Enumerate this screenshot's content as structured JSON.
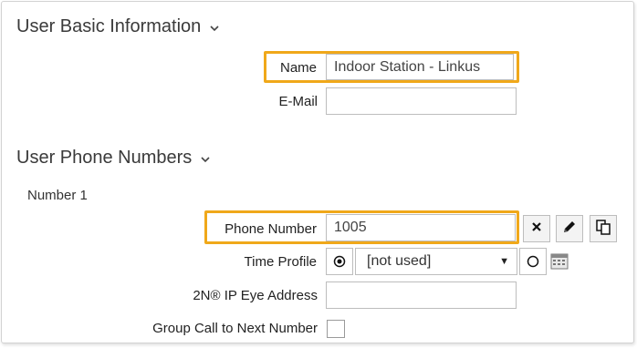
{
  "basic_info": {
    "title": "User Basic Information",
    "name_label": "Name",
    "name_value": "Indoor Station - Linkus",
    "email_label": "E-Mail",
    "email_value": ""
  },
  "phone_numbers": {
    "title": "User Phone Numbers",
    "number_heading": "Number 1",
    "phone_label": "Phone Number",
    "phone_value": "1005",
    "time_profile_label": "Time Profile",
    "time_profile_value": "[not used]",
    "eye_address_label": "2N® IP Eye Address",
    "eye_address_value": "",
    "group_call_label": "Group Call to Next Number",
    "group_call_checked": false
  },
  "icons": {
    "section_toggle": "chevron-down-icon",
    "clear": "close-icon",
    "edit": "pencil-icon",
    "copy": "copy-icon",
    "calendar": "calendar-icon"
  },
  "colors": {
    "highlight": "#f0a81a"
  }
}
